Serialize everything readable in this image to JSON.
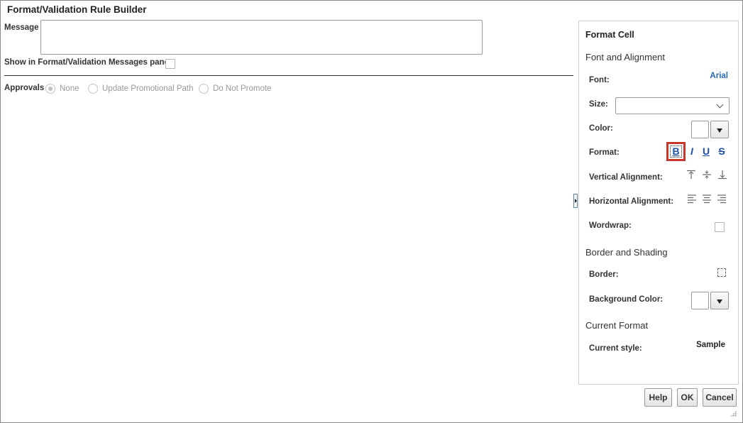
{
  "dialog": {
    "title": "Format/Validation Rule Builder"
  },
  "message": {
    "label": "Message",
    "value": ""
  },
  "show_in_pane": {
    "label": "Show in Format/Validation Messages pane",
    "checked": false
  },
  "approvals": {
    "label": "Approvals",
    "options": [
      {
        "label": "None",
        "selected": true
      },
      {
        "label": "Update Promotional Path",
        "selected": false
      },
      {
        "label": "Do Not Promote",
        "selected": false
      }
    ]
  },
  "format_cell": {
    "title": "Format Cell",
    "font_alignment_section": "Font and Alignment",
    "font_label": "Font:",
    "font_value": "Arial",
    "size_label": "Size:",
    "size_value": "",
    "color_label": "Color:",
    "format_label": "Format:",
    "format_buttons": {
      "bold": "B",
      "italic": "I",
      "underline": "U",
      "strike": "S"
    },
    "vertical_alignment_label": "Vertical Alignment:",
    "horizontal_alignment_label": "Horizontal Alignment:",
    "wordwrap_label": "Wordwrap:",
    "border_shading_section": "Border and Shading",
    "border_label": "Border:",
    "background_color_label": "Background Color:",
    "current_format_section": "Current Format",
    "current_style_label": "Current style:",
    "current_style_value": "Sample"
  },
  "buttons": {
    "help": "Help",
    "ok": "OK",
    "cancel": "Cancel"
  },
  "colors": {
    "highlight": "#c9372c",
    "format_icon": "#1f4fa8",
    "font_value": "#2a6ab8"
  }
}
